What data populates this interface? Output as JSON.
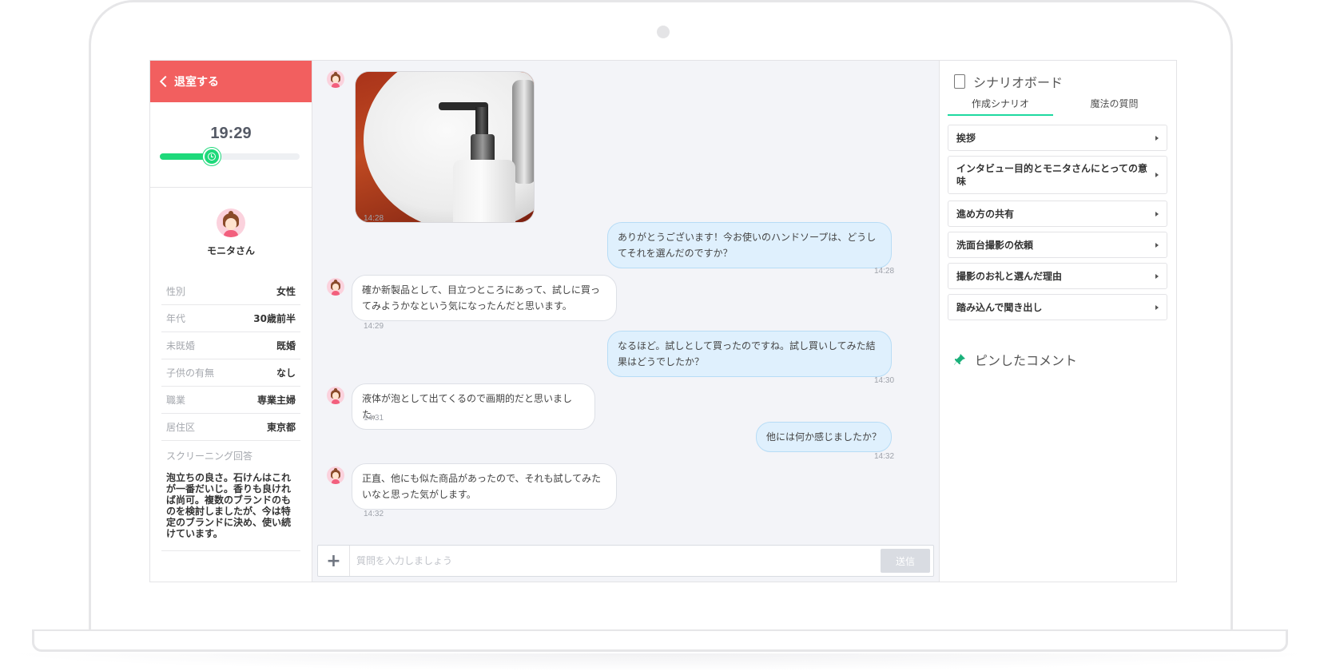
{
  "left": {
    "exit_label": "退室する",
    "timer": "19:29",
    "progress": 0.37,
    "profile_name": "モニタさん",
    "attributes": [
      {
        "key": "性別",
        "value": "女性"
      },
      {
        "key": "年代",
        "value": "30歳前半"
      },
      {
        "key": "未既婚",
        "value": "既婚"
      },
      {
        "key": "子供の有無",
        "value": "なし"
      },
      {
        "key": "職業",
        "value": "専業主婦"
      },
      {
        "key": "居住区",
        "value": "東京都"
      }
    ],
    "screening_label": "スクリーニング回答",
    "screening_answer": "泡立ちの良さ。石けんはこれが一番だいじ。香りも良ければ尚可。複数のブランドのものを検討しましたが、今は特定のブランドに決め、使い続けています。"
  },
  "chat": {
    "messages": [
      {
        "type": "image",
        "time": "14:28"
      },
      {
        "type": "out",
        "text": "ありがとうございます！今お使いのハンドソープは、どうしてそれを選んだのですか？",
        "time": "14:28"
      },
      {
        "type": "in",
        "text": "確か新製品として、目立つところにあって、試しに買ってみようかなという気になったんだと思います。",
        "time": "14:29"
      },
      {
        "type": "out",
        "text": "なるほど。試しとして買ったのですね。試し買いしてみた結果はどうでしたか？",
        "time": "14:30"
      },
      {
        "type": "in",
        "text": "液体が泡として出てくるので画期的だと思いました。",
        "time": "14:31"
      },
      {
        "type": "out",
        "text": "他には何か感じましたか？",
        "time": "14:32"
      },
      {
        "type": "in",
        "text": "正直、他にも似た商品があったので、それも試してみたいなと思った気がします。",
        "time": "14:32"
      }
    ],
    "input_placeholder": "質問を入力しましょう",
    "send_label": "送信",
    "plus_label": "+"
  },
  "right": {
    "title": "シナリオボード",
    "tabs": [
      "作成シナリオ",
      "魔法の質問"
    ],
    "active_tab": 0,
    "scenes": [
      "挨拶",
      "インタビュー目的とモニタさんにとっての意味",
      "進め方の共有",
      "洗面台撮影の依頼",
      "撮影のお礼と選んだ理由",
      "踏み込んで聞き出し"
    ],
    "pinned_label": "ピンしたコメント"
  },
  "colors": {
    "exit_bar": "#f25f5f",
    "progress": "#1ed97a",
    "tab_underline": "#1ed9a0",
    "outgoing_bubble": "#dff0fd",
    "pin": "#1ab07a"
  }
}
